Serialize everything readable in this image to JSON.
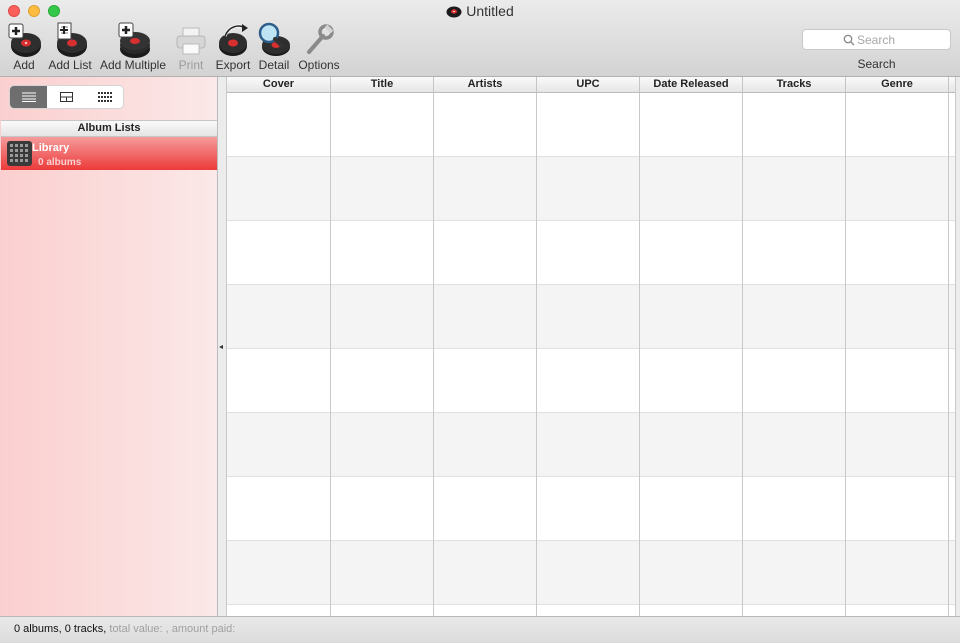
{
  "window": {
    "title": "Untitled"
  },
  "toolbar": {
    "buttons": [
      {
        "id": "add",
        "label": "Add",
        "icon": "add-album-icon",
        "enabled": true
      },
      {
        "id": "add_list",
        "label": "Add List",
        "icon": "add-list-icon",
        "enabled": true
      },
      {
        "id": "add_multiple",
        "label": "Add Multiple",
        "icon": "add-multiple-icon",
        "enabled": true
      },
      {
        "id": "print",
        "label": "Print",
        "icon": "printer-icon",
        "enabled": false
      },
      {
        "id": "export",
        "label": "Export",
        "icon": "export-icon",
        "enabled": true
      },
      {
        "id": "detail",
        "label": "Detail",
        "icon": "magnifier-icon",
        "enabled": true
      },
      {
        "id": "options",
        "label": "Options",
        "icon": "wrench-icon",
        "enabled": true
      }
    ],
    "search": {
      "placeholder": "Search",
      "value": "",
      "label": "Search"
    }
  },
  "sidebar": {
    "view_modes": [
      {
        "name": "list-view",
        "icon": "list-icon",
        "active": true
      },
      {
        "name": "grid-view",
        "icon": "split-grid-icon",
        "active": false
      },
      {
        "name": "cover-view",
        "icon": "cover-grid-icon",
        "active": false
      }
    ],
    "header": "Album Lists",
    "lists": [
      {
        "name": "Library",
        "count": "0 albums",
        "selected": true
      }
    ]
  },
  "table": {
    "columns": [
      "Cover",
      "Title",
      "Artists",
      "UPC",
      "Date Released",
      "Tracks",
      "Genre"
    ],
    "rows": []
  },
  "status": {
    "main": "0 albums, 0 tracks,",
    "extra": " total value: , amount paid:"
  },
  "colors": {
    "sidebar_selected": "#ec3a3a",
    "sidebar_bg": "#fbcfcf",
    "accent_disabled": "#9b9b9b"
  }
}
